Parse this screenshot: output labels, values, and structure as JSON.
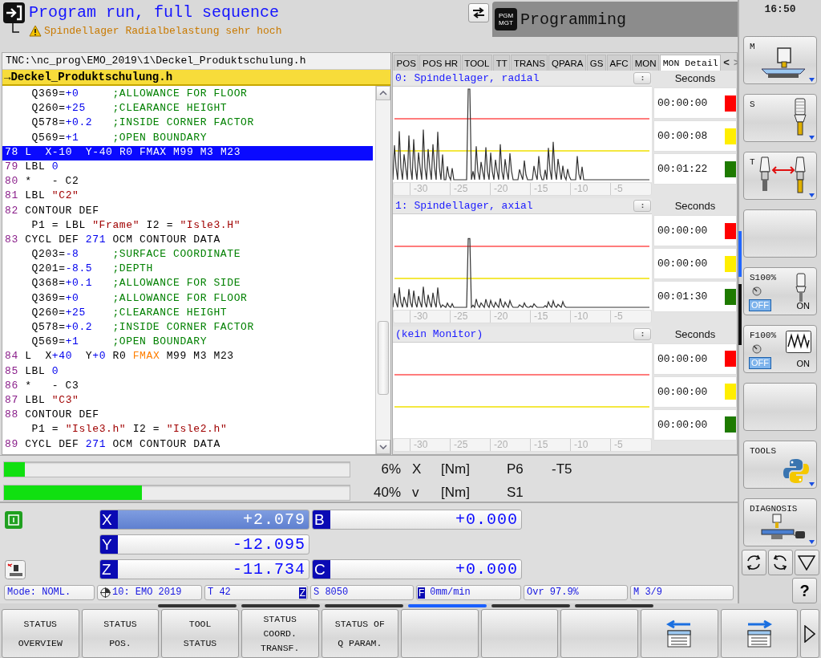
{
  "header": {
    "mode_title": "Program run, full sequence",
    "warning": "Spindellager Radialbelastung sehr hoch",
    "other_mode": {
      "key_lines": [
        "PGM",
        "MGT"
      ],
      "title": "Programming"
    }
  },
  "clock": "16:50",
  "program": {
    "path": "TNC:\\nc_prog\\EMO_2019\\1\\Deckel_Produktschulung.h",
    "file": "→Deckel_Produktschulung.h",
    "lines": [
      {
        "selected": false,
        "segments": [
          {
            "kind": "plain",
            "text": "    Q369="
          },
          {
            "kind": "value",
            "text": "+0     "
          },
          {
            "kind": "comment",
            "text": ";ALLOWANCE FOR FLOOR"
          }
        ]
      },
      {
        "selected": false,
        "segments": [
          {
            "kind": "plain",
            "text": "    Q260="
          },
          {
            "kind": "value",
            "text": "+25    "
          },
          {
            "kind": "comment",
            "text": ";CLEARANCE HEIGHT"
          }
        ]
      },
      {
        "selected": false,
        "segments": [
          {
            "kind": "plain",
            "text": "    Q578="
          },
          {
            "kind": "value",
            "text": "+0.2   "
          },
          {
            "kind": "comment",
            "text": ";INSIDE CORNER FACTOR"
          }
        ]
      },
      {
        "selected": false,
        "segments": [
          {
            "kind": "plain",
            "text": "    Q569="
          },
          {
            "kind": "value",
            "text": "+1     "
          },
          {
            "kind": "comment",
            "text": ";OPEN BOUNDARY"
          }
        ]
      },
      {
        "selected": true,
        "segments": [
          {
            "kind": "line_no",
            "text": "78"
          },
          {
            "kind": "plain",
            "text": " L  X"
          },
          {
            "kind": "value",
            "text": "-10"
          },
          {
            "kind": "plain",
            "text": "  Y"
          },
          {
            "kind": "value",
            "text": "-40"
          },
          {
            "kind": "plain",
            "text": " R0 "
          },
          {
            "kind": "rapid",
            "text": "FMAX"
          },
          {
            "kind": "plain",
            "text": " M99 M3 M23"
          }
        ]
      },
      {
        "selected": false,
        "segments": [
          {
            "kind": "line_no",
            "text": "79"
          },
          {
            "kind": "plain",
            "text": " LBL "
          },
          {
            "kind": "value",
            "text": "0"
          }
        ]
      },
      {
        "selected": false,
        "segments": [
          {
            "kind": "line_no",
            "text": "80"
          },
          {
            "kind": "plain",
            "text": " *   - C2"
          }
        ]
      },
      {
        "selected": false,
        "segments": [
          {
            "kind": "line_no",
            "text": "81"
          },
          {
            "kind": "plain",
            "text": " LBL "
          },
          {
            "kind": "string",
            "text": "\"C2\""
          }
        ]
      },
      {
        "selected": false,
        "segments": [
          {
            "kind": "line_no",
            "text": "82"
          },
          {
            "kind": "plain",
            "text": " CONTOUR DEF"
          }
        ]
      },
      {
        "selected": false,
        "segments": [
          {
            "kind": "plain",
            "text": "    P1 = LBL "
          },
          {
            "kind": "string",
            "text": "\"Frame\""
          },
          {
            "kind": "plain",
            "text": " I2 = "
          },
          {
            "kind": "string",
            "text": "\"Isle3.H\""
          }
        ]
      },
      {
        "selected": false,
        "segments": [
          {
            "kind": "line_no",
            "text": "83"
          },
          {
            "kind": "plain",
            "text": " CYCL DEF "
          },
          {
            "kind": "value",
            "text": "271"
          },
          {
            "kind": "plain",
            "text": " OCM CONTOUR DATA"
          }
        ]
      },
      {
        "selected": false,
        "segments": [
          {
            "kind": "plain",
            "text": "    Q203="
          },
          {
            "kind": "value",
            "text": "-8     "
          },
          {
            "kind": "comment",
            "text": ";SURFACE COORDINATE"
          }
        ]
      },
      {
        "selected": false,
        "segments": [
          {
            "kind": "plain",
            "text": "    Q201="
          },
          {
            "kind": "value",
            "text": "-8.5   "
          },
          {
            "kind": "comment",
            "text": ";DEPTH"
          }
        ]
      },
      {
        "selected": false,
        "segments": [
          {
            "kind": "plain",
            "text": "    Q368="
          },
          {
            "kind": "value",
            "text": "+0.1   "
          },
          {
            "kind": "comment",
            "text": ";ALLOWANCE FOR SIDE"
          }
        ]
      },
      {
        "selected": false,
        "segments": [
          {
            "kind": "plain",
            "text": "    Q369="
          },
          {
            "kind": "value",
            "text": "+0     "
          },
          {
            "kind": "comment",
            "text": ";ALLOWANCE FOR FLOOR"
          }
        ]
      },
      {
        "selected": false,
        "segments": [
          {
            "kind": "plain",
            "text": "    Q260="
          },
          {
            "kind": "value",
            "text": "+25    "
          },
          {
            "kind": "comment",
            "text": ";CLEARANCE HEIGHT"
          }
        ]
      },
      {
        "selected": false,
        "segments": [
          {
            "kind": "plain",
            "text": "    Q578="
          },
          {
            "kind": "value",
            "text": "+0.2   "
          },
          {
            "kind": "comment",
            "text": ";INSIDE CORNER FACTOR"
          }
        ]
      },
      {
        "selected": false,
        "segments": [
          {
            "kind": "plain",
            "text": "    Q569="
          },
          {
            "kind": "value",
            "text": "+1     "
          },
          {
            "kind": "comment",
            "text": ";OPEN BOUNDARY"
          }
        ]
      },
      {
        "selected": false,
        "segments": [
          {
            "kind": "line_no",
            "text": "84"
          },
          {
            "kind": "plain",
            "text": " L  X"
          },
          {
            "kind": "value",
            "text": "+40"
          },
          {
            "kind": "plain",
            "text": "  Y"
          },
          {
            "kind": "value",
            "text": "+0"
          },
          {
            "kind": "plain",
            "text": " R0 "
          },
          {
            "kind": "rapid",
            "text": "FMAX"
          },
          {
            "kind": "plain",
            "text": " M99 M3 M23"
          }
        ]
      },
      {
        "selected": false,
        "segments": [
          {
            "kind": "line_no",
            "text": "85"
          },
          {
            "kind": "plain",
            "text": " LBL "
          },
          {
            "kind": "value",
            "text": "0"
          }
        ]
      },
      {
        "selected": false,
        "segments": [
          {
            "kind": "line_no",
            "text": "86"
          },
          {
            "kind": "plain",
            "text": " *   - C3"
          }
        ]
      },
      {
        "selected": false,
        "segments": [
          {
            "kind": "line_no",
            "text": "87"
          },
          {
            "kind": "plain",
            "text": " LBL "
          },
          {
            "kind": "string",
            "text": "\"C3\""
          }
        ]
      },
      {
        "selected": false,
        "segments": [
          {
            "kind": "line_no",
            "text": "88"
          },
          {
            "kind": "plain",
            "text": " CONTOUR DEF"
          }
        ]
      },
      {
        "selected": false,
        "segments": [
          {
            "kind": "plain",
            "text": "    P1 = "
          },
          {
            "kind": "string",
            "text": "\"Isle3.h\""
          },
          {
            "kind": "plain",
            "text": " I2 = "
          },
          {
            "kind": "string",
            "text": "\"Isle2.h\""
          }
        ]
      },
      {
        "selected": false,
        "segments": [
          {
            "kind": "line_no",
            "text": "89"
          },
          {
            "kind": "plain",
            "text": " CYCL DEF "
          },
          {
            "kind": "value",
            "text": "271"
          },
          {
            "kind": "plain",
            "text": " OCM CONTOUR DATA"
          }
        ]
      }
    ]
  },
  "status_tabs": [
    {
      "label": "POS",
      "selected": false
    },
    {
      "label": "POS HR",
      "selected": false
    },
    {
      "label": "TOOL",
      "selected": false
    },
    {
      "label": "TT",
      "selected": false
    },
    {
      "label": "TRANS",
      "selected": false
    },
    {
      "label": "QPARA",
      "selected": false
    },
    {
      "label": "GS",
      "selected": false
    },
    {
      "label": "AFC",
      "selected": false
    },
    {
      "label": "MON",
      "selected": false
    },
    {
      "label": "MON Detail",
      "selected": true
    }
  ],
  "tab_scroll": [
    {
      "label": "<",
      "disabled": false
    },
    {
      "label": ">",
      "disabled": true
    }
  ],
  "monitors": [
    {
      "title": "0: Spindellager, radial",
      "kind": "large",
      "axis_labels": [
        "-30",
        "-25",
        "-20",
        "-15",
        "-10",
        "-5"
      ],
      "times_heading": "Seconds",
      "times": [
        {
          "value": "00:00:00",
          "color": "#ff0000"
        },
        {
          "value": "00:00:08",
          "color": "#ffee00"
        },
        {
          "value": "00:01:22",
          "color": "#1e7a00"
        }
      ]
    },
    {
      "title": "1: Spindellager, axial",
      "kind": "small",
      "axis_labels": [
        "-30",
        "-25",
        "-20",
        "-15",
        "-10",
        "-5"
      ],
      "times_heading": "Seconds",
      "times": [
        {
          "value": "00:00:00",
          "color": "#ff0000"
        },
        {
          "value": "00:00:00",
          "color": "#ffee00"
        },
        {
          "value": "00:01:30",
          "color": "#1e7a00"
        }
      ]
    },
    {
      "title": "(kein Monitor)",
      "kind": "none",
      "axis_labels": [
        "-30",
        "-25",
        "-20",
        "-15",
        "-10",
        "-5"
      ],
      "times_heading": "Seconds",
      "times": [
        {
          "value": "00:00:00",
          "color": "#ff0000"
        },
        {
          "value": "00:00:00",
          "color": "#ffee00"
        },
        {
          "value": "00:00:00",
          "color": "#1e7a00"
        }
      ]
    }
  ],
  "load_bars": [
    {
      "level": 0.06,
      "percent": "6%",
      "axis": "X",
      "unit": "[Nm]",
      "label_1": "P6",
      "label_2": "-T5"
    },
    {
      "level": 0.4,
      "percent": "40%",
      "axis": "v",
      "unit": "[Nm]",
      "label_1": "S1"
    }
  ],
  "axis_rows": [
    [
      {
        "letter": "X",
        "value": "+2.079",
        "active": true
      },
      {
        "letter": "B",
        "value": "+0.000",
        "active": false
      }
    ],
    [
      {
        "letter": "Y",
        "value": "-12.095",
        "active": false
      }
    ],
    [
      {
        "letter": "Z",
        "value": "-11.734",
        "active": false
      },
      {
        "letter": "C",
        "value": "+0.000",
        "active": false
      }
    ]
  ],
  "status_line": {
    "mode": "Mode: NOML.",
    "datum": "10: EMO 2019",
    "tool": "T 42",
    "tool_axis": "Z",
    "spindle": "S 8050",
    "feed_badge": "F",
    "feed": "0mm/min",
    "override": "Ovr 97.9%",
    "m_functions": "M 3/9"
  },
  "side_pages": [
    {
      "selected": true
    },
    {
      "selected": false
    }
  ],
  "side_keys": [
    {
      "kind": "machine",
      "label": "M",
      "has_menu": true
    },
    {
      "kind": "spindle",
      "label": "S",
      "has_menu": true
    },
    {
      "kind": "tool-change",
      "label": "T",
      "has_menu": true
    },
    {
      "kind": "blank",
      "has_menu": false
    },
    {
      "kind": "spindle-override",
      "label": "S100%",
      "off_label": "OFF",
      "on_label": "ON",
      "on": false,
      "has_menu": false
    },
    {
      "kind": "feed-override",
      "label": "F100%",
      "off_label": "OFF",
      "on_label": "ON",
      "on": false,
      "has_menu": false
    },
    {
      "kind": "blank",
      "has_menu": false
    },
    {
      "kind": "tools",
      "label": "TOOLS",
      "has_menu": true
    },
    {
      "kind": "diagnosis",
      "label": "DIAGNOSIS",
      "has_menu": true
    }
  ],
  "side_small_keys": [
    {
      "kind": "rotate-left"
    },
    {
      "kind": "rotate-right"
    },
    {
      "kind": "triangle"
    }
  ],
  "help_key": "?",
  "softkey_pages": [
    {
      "selected": false
    },
    {
      "selected": false
    },
    {
      "selected": false
    },
    {
      "selected": true
    },
    {
      "selected": false
    },
    {
      "selected": false
    }
  ],
  "softkeys": [
    {
      "kind": "text",
      "lines": [
        "STATUS",
        "OVERVIEW"
      ]
    },
    {
      "kind": "text",
      "lines": [
        "STATUS",
        "POS."
      ]
    },
    {
      "kind": "text",
      "lines": [
        "TOOL",
        "STATUS"
      ]
    },
    {
      "kind": "text",
      "lines": [
        "STATUS",
        "COORD.",
        "TRANSF."
      ]
    },
    {
      "kind": "text",
      "lines": [
        "STATUS OF",
        "Q PARAM."
      ]
    },
    {
      "kind": "blank"
    },
    {
      "kind": "blank"
    },
    {
      "kind": "blank"
    },
    {
      "kind": "back"
    },
    {
      "kind": "forward"
    },
    {
      "kind": "more"
    }
  ]
}
